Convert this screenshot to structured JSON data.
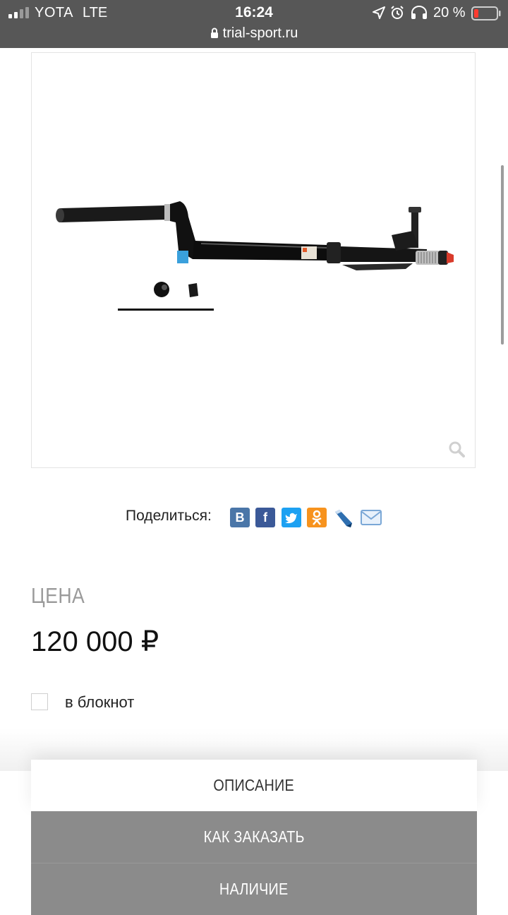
{
  "status_bar": {
    "carrier": "YOTA",
    "network": "LTE",
    "time": "16:24",
    "battery_percent": "20 %",
    "battery_level": 0.2,
    "url": "trial-sport.ru"
  },
  "product": {
    "image_icon": "suspension-fork-image",
    "zoom_icon": "magnifier-icon"
  },
  "share": {
    "label": "Поделиться:",
    "buttons": [
      {
        "name": "vk",
        "glyph": "B",
        "color": "#4a76a8"
      },
      {
        "name": "facebook",
        "glyph": "f",
        "color": "#3b5998"
      },
      {
        "name": "twitter",
        "glyph": "t",
        "color": "#1da1f2"
      },
      {
        "name": "odnoklassniki",
        "glyph": "ok",
        "color": "#f7931e"
      },
      {
        "name": "livejournal",
        "glyph": "lj",
        "color": "#2f6fb0"
      },
      {
        "name": "email",
        "glyph": "mail",
        "color": "#8ab6e0"
      }
    ]
  },
  "price": {
    "label": "ЦЕНА",
    "value": "120 000 ₽"
  },
  "notepad": {
    "label": "в блокнот",
    "checked": false
  },
  "tabs": [
    {
      "label": "ОПИСАНИЕ",
      "active": true
    },
    {
      "label": "КАК ЗАКАЗАТЬ",
      "active": false
    },
    {
      "label": "НАЛИЧИЕ",
      "active": false
    }
  ],
  "colors": {
    "status_bar_bg": "#575757",
    "tab_inactive_bg": "#8b8b8b",
    "price_label": "#9a9a9a"
  }
}
